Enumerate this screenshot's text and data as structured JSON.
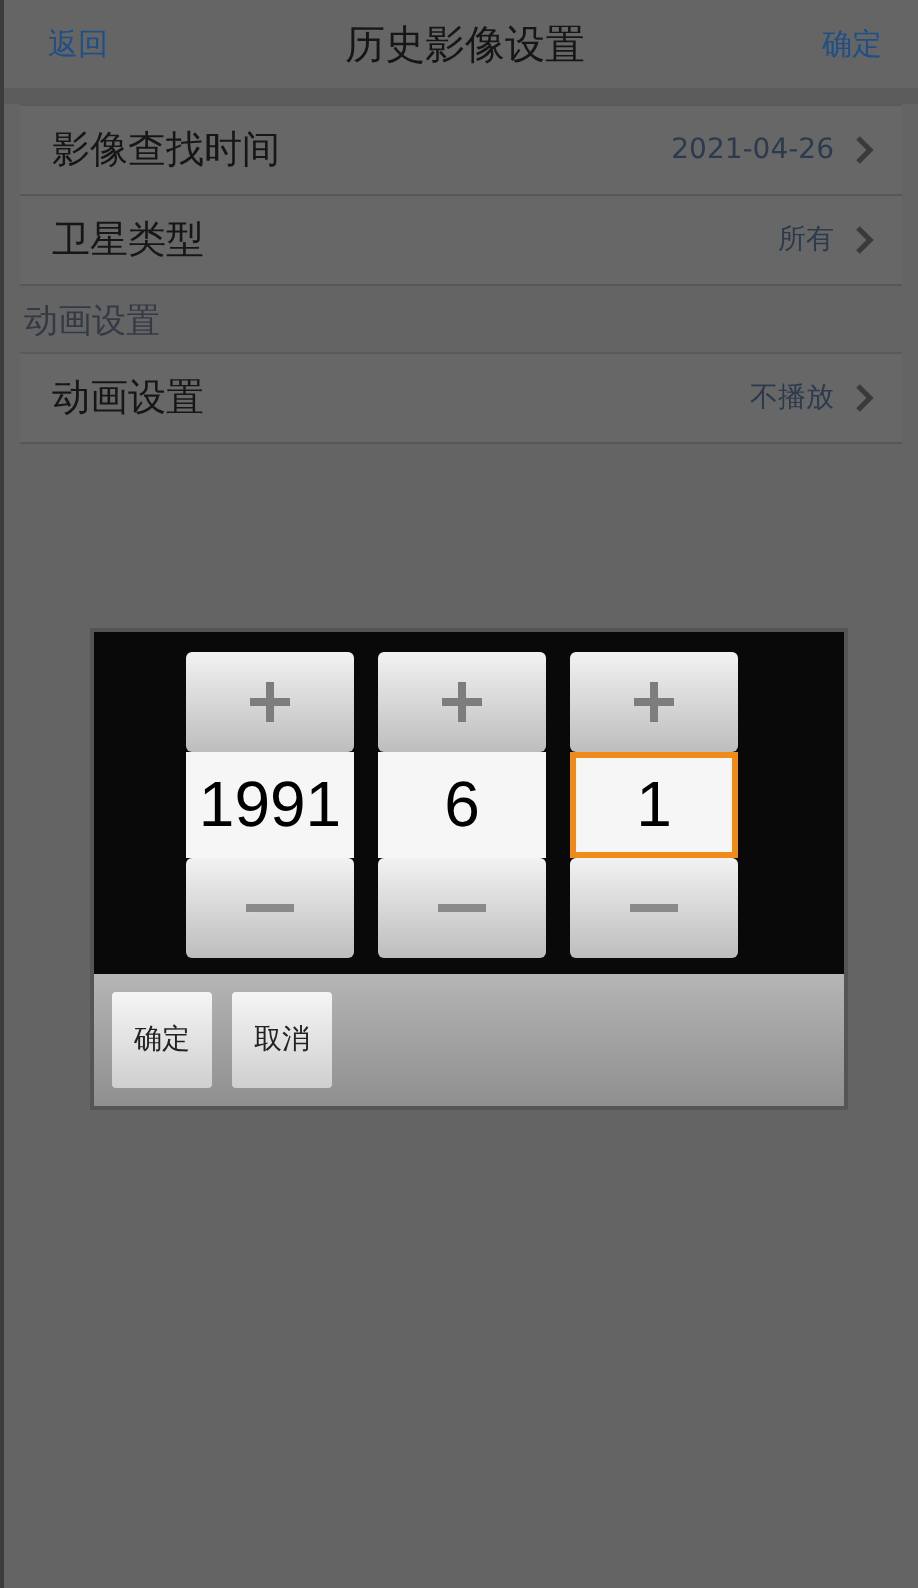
{
  "header": {
    "back": "返回",
    "title": "历史影像设置",
    "confirm": "确定"
  },
  "groups": [
    {
      "rows": [
        {
          "label": "影像查找时间",
          "value": "2021-04-26"
        },
        {
          "label": "卫星类型",
          "value": "所有"
        }
      ]
    },
    {
      "heading": "动画设置",
      "rows": [
        {
          "label": "动画设置",
          "value": "不播放"
        }
      ]
    }
  ],
  "dialog": {
    "spinners": [
      {
        "value": "1991",
        "selected": false
      },
      {
        "value": "6",
        "selected": false
      },
      {
        "value": "1",
        "selected": true
      }
    ],
    "buttons": [
      "确定",
      "取消"
    ]
  }
}
